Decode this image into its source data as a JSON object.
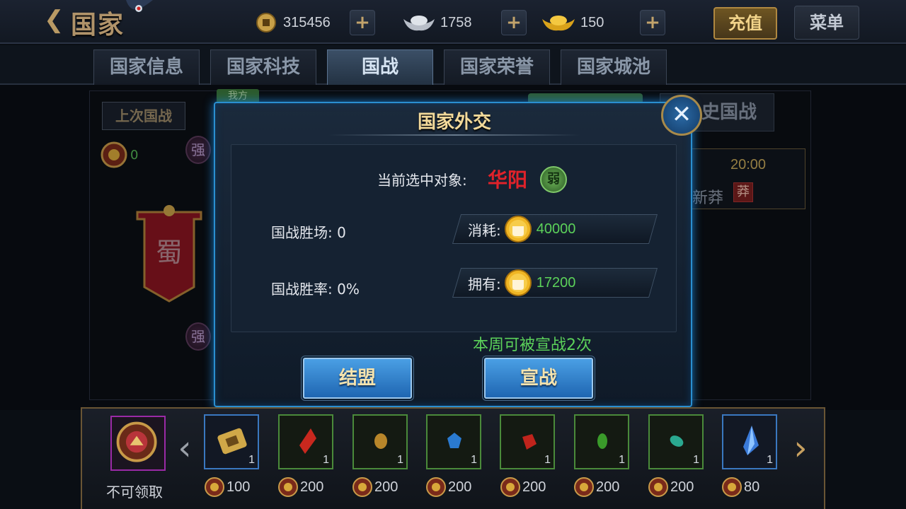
{
  "header": {
    "back_icon": "chevron-left-icon",
    "title": "国家",
    "copper": "315456",
    "silver": "1758",
    "gold": "150",
    "recharge": "充值",
    "menu": "菜单"
  },
  "tabs": [
    {
      "label": "国家信息",
      "active": false
    },
    {
      "label": "国家科技",
      "active": false
    },
    {
      "label": "国战",
      "active": true
    },
    {
      "label": "国家荣誉",
      "active": false
    },
    {
      "label": "国家城池",
      "active": false
    }
  ],
  "background": {
    "last_war": "上次国战",
    "mine_tag": "我方",
    "history": "史国战",
    "coin_count": "0",
    "strong_badge": "强",
    "banner_text": "蜀",
    "time": "20:00",
    "city": "新莽",
    "city_badge": "莽"
  },
  "modal": {
    "title": "国家外交",
    "target_label": "当前选中对象:",
    "target_name": "华阳",
    "target_badge": "弱",
    "wins_label": "国战胜场:",
    "wins_value": "0",
    "rate_label": "国战胜率:",
    "rate_value": "0%",
    "cost_label": "消耗:",
    "cost_value": "40000",
    "own_label": "拥有:",
    "own_value": "17200",
    "declare_note": "本周可被宣战2次",
    "ally_button": "结盟",
    "war_button": "宣战",
    "close_icon": "close-icon"
  },
  "rewards": {
    "lock_label": "不可领取",
    "items": [
      {
        "icon": "token-icon",
        "qty": "1",
        "cost": "100",
        "color": "blue"
      },
      {
        "icon": "red-crystal-icon",
        "qty": "1",
        "cost": "200",
        "color": "green"
      },
      {
        "icon": "gold-ore-icon",
        "qty": "1",
        "cost": "200",
        "color": "green"
      },
      {
        "icon": "blue-gem-icon",
        "qty": "1",
        "cost": "200",
        "color": "green"
      },
      {
        "icon": "ruby-icon",
        "qty": "1",
        "cost": "200",
        "color": "green"
      },
      {
        "icon": "green-gem-icon",
        "qty": "1",
        "cost": "200",
        "color": "green"
      },
      {
        "icon": "teal-gem-icon",
        "qty": "1",
        "cost": "200",
        "color": "green"
      },
      {
        "icon": "blue-shard-icon",
        "qty": "1",
        "cost": "80",
        "color": "blue"
      }
    ]
  },
  "colors": {
    "accent_gold": "#f2d99a",
    "positive_green": "#5cd25a",
    "enemy_red": "#e0222a",
    "modal_border": "#2a8fd0"
  }
}
